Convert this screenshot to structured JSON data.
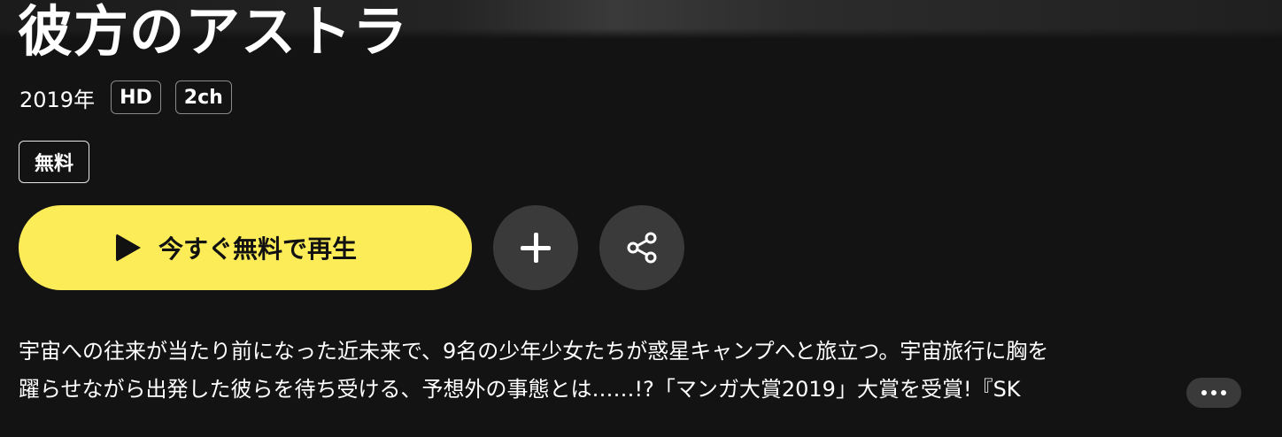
{
  "title": "彼方のアストラ",
  "meta": {
    "year": "2019年",
    "tags": [
      "HD",
      "2ch"
    ]
  },
  "badge": "無料",
  "actions": {
    "play_label": "今すぐ無料で再生",
    "add_icon": "plus-icon",
    "share_icon": "share-icon",
    "accent_color": "#fcec58"
  },
  "description": {
    "line1": "宇宙への往来が当たり前になった近未来で、9名の少年少女たちが惑星キャンプへと旅立つ。宇宙旅行に胸を",
    "line2": "躍らせながら出発した彼らを待ち受ける、予想外の事態とは……!?「マンガ大賞2019」大賞を受賞!『SK",
    "more_icon": "ellipsis-icon"
  }
}
